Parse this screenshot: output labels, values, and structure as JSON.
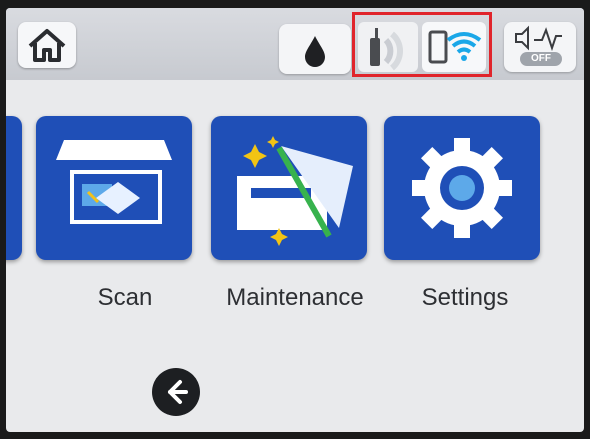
{
  "header": {
    "home_icon": "home-icon",
    "ink_icon": "ink-drop-icon",
    "fax_icon": "fax-status-icon",
    "wifi_icon": "wifi-status-icon",
    "sound_icon": "sound-status-icon",
    "sound_status": "OFF"
  },
  "menu": {
    "items": [
      {
        "label": "Scan",
        "icon": "scan-icon"
      },
      {
        "label": "Maintenance",
        "icon": "maintenance-icon"
      },
      {
        "label": "Settings",
        "icon": "settings-icon"
      }
    ]
  },
  "nav": {
    "back_icon": "back-arrow-icon"
  },
  "colors": {
    "tile_blue": "#1f4fb7",
    "highlight_red": "#e0242b",
    "wifi_blue": "#1aa7e8"
  }
}
